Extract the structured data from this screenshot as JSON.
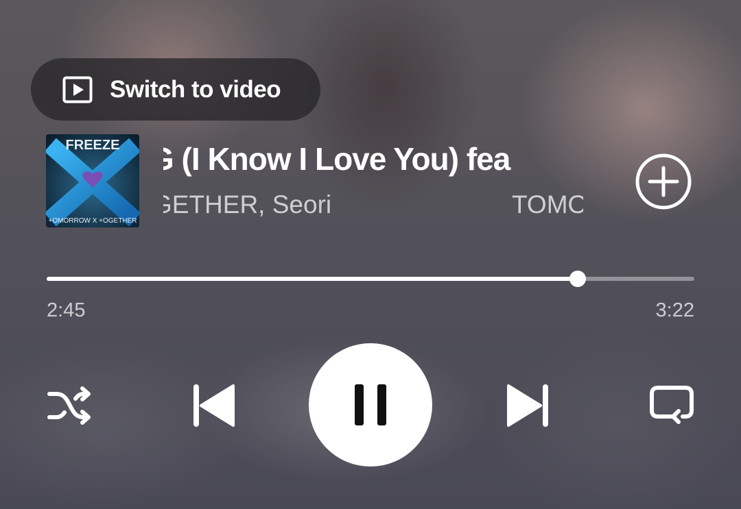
{
  "switch_video": {
    "label": "Switch to video",
    "icon": "play-square-icon"
  },
  "album": {
    "title_text": "FREEZE",
    "bottom_text": "+OMORROW X +OGETHER"
  },
  "track": {
    "title": "G (I Know I Love You) fea",
    "artist_visible": "GETHER, Seori",
    "artist_loop": "TOMO"
  },
  "playback": {
    "elapsed": "2:45",
    "total": "3:22",
    "progress_fraction": 0.82
  },
  "controls": {
    "shuffle_icon": "shuffle-icon",
    "prev_icon": "skip-previous-icon",
    "pause_icon": "pause-icon",
    "next_icon": "skip-next-icon",
    "repeat_icon": "repeat-icon",
    "add_icon": "add-circle-icon"
  },
  "colors": {
    "accent": "#ffffff",
    "album_x": "#1f8fd6",
    "album_heart": "#7a4fb5"
  }
}
